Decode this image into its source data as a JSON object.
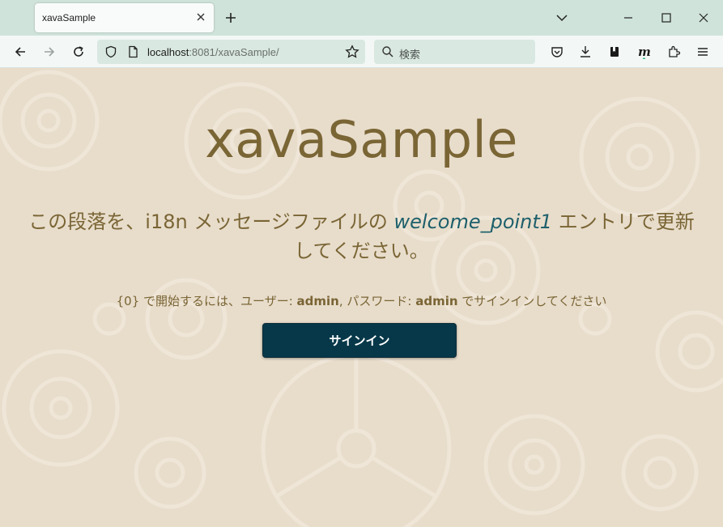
{
  "browser": {
    "tab_title": "xavaSample",
    "url_host": "localhost",
    "url_rest": ":8081/xavaSample/",
    "search_placeholder": "検索"
  },
  "page": {
    "title": "xavaSample",
    "welcome_prefix": "この段落を、",
    "welcome_i18n": "i18n",
    "welcome_middle": " メッセージファイルの ",
    "welcome_key": "welcome_point1",
    "welcome_suffix": " エントリで更新してください。",
    "instr_prefix": "{0} で開始するには、ユーザー: ",
    "instr_user": "admin",
    "instr_middle": ", パスワード: ",
    "instr_password": "admin",
    "instr_suffix": " でサインインしてください",
    "signin_label": "サインイン"
  },
  "colors": {
    "background": "#e8ddcb",
    "title": "#7a6535",
    "key_highlight": "#1d5f6b",
    "button": "#063849",
    "tabstrip": "#cfe3da"
  }
}
